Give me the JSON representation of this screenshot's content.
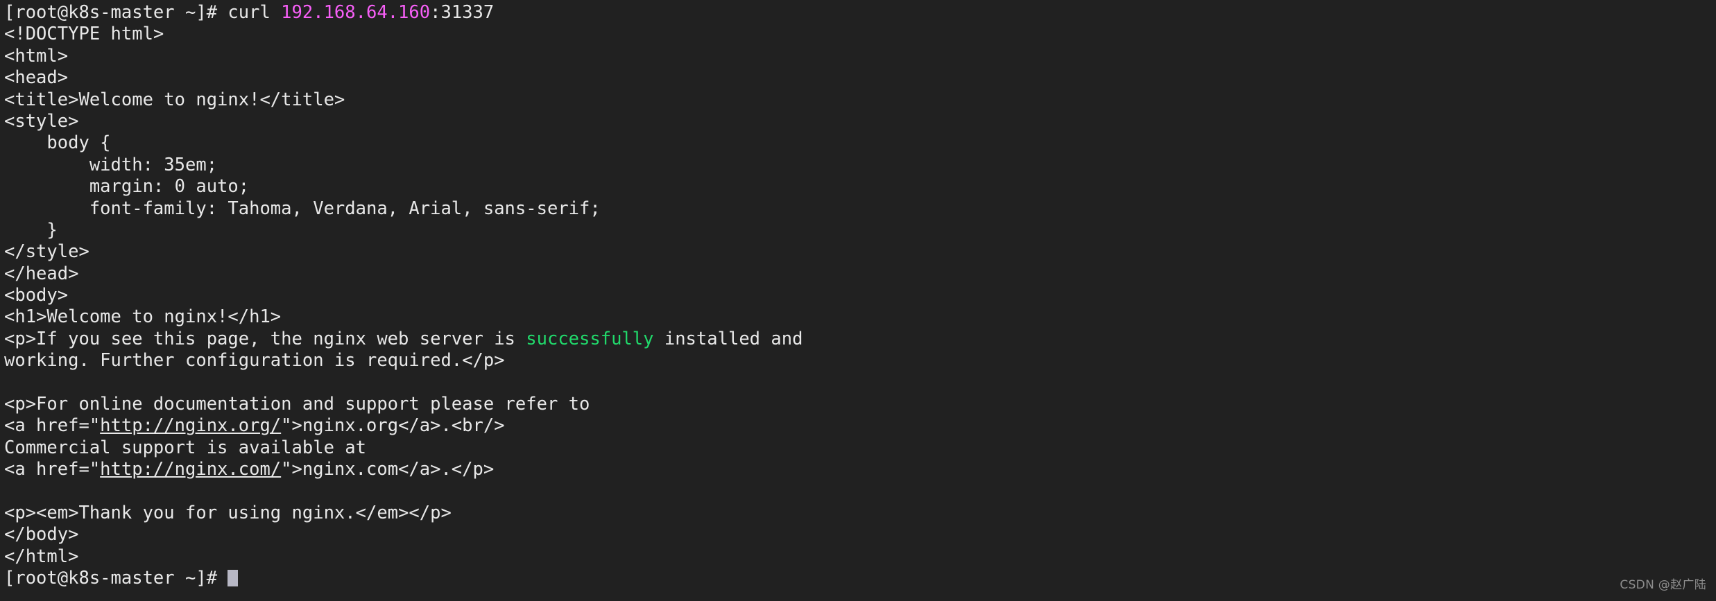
{
  "terminal": {
    "background_color": "#212121",
    "foreground_color": "#e8e8e8",
    "magenta_color": "#f75ff7",
    "green_color": "#21d96b",
    "cursor_color": "#b7b7c4",
    "prompt": "[root@k8s-master ~]# ",
    "command": "curl ",
    "host": "192.168.64.160",
    "port": ":31337",
    "lines": [
      {
        "id": "line-1-prompt-command",
        "segments": [
          {
            "text": "[root@k8s-master ~]# curl ",
            "color": "default"
          },
          {
            "text": "192.168.64.160",
            "color": "magenta"
          },
          {
            "text": ":31337",
            "color": "default"
          }
        ]
      },
      {
        "id": "line-2",
        "segments": [
          {
            "text": "<!DOCTYPE html>",
            "color": "default"
          }
        ]
      },
      {
        "id": "line-3",
        "segments": [
          {
            "text": "<html>",
            "color": "default"
          }
        ]
      },
      {
        "id": "line-4",
        "segments": [
          {
            "text": "<head>",
            "color": "default"
          }
        ]
      },
      {
        "id": "line-5",
        "segments": [
          {
            "text": "<title>Welcome to nginx!</title>",
            "color": "default"
          }
        ]
      },
      {
        "id": "line-6",
        "segments": [
          {
            "text": "<style>",
            "color": "default"
          }
        ]
      },
      {
        "id": "line-7",
        "segments": [
          {
            "text": "    body {",
            "color": "default"
          }
        ]
      },
      {
        "id": "line-8",
        "segments": [
          {
            "text": "        width: 35em;",
            "color": "default"
          }
        ]
      },
      {
        "id": "line-9",
        "segments": [
          {
            "text": "        margin: 0 auto;",
            "color": "default"
          }
        ]
      },
      {
        "id": "line-10",
        "segments": [
          {
            "text": "        font-family: Tahoma, Verdana, Arial, sans-serif;",
            "color": "default"
          }
        ]
      },
      {
        "id": "line-11",
        "segments": [
          {
            "text": "    }",
            "color": "default"
          }
        ]
      },
      {
        "id": "line-12",
        "segments": [
          {
            "text": "</style>",
            "color": "default"
          }
        ]
      },
      {
        "id": "line-13",
        "segments": [
          {
            "text": "</head>",
            "color": "default"
          }
        ]
      },
      {
        "id": "line-14",
        "segments": [
          {
            "text": "<body>",
            "color": "default"
          }
        ]
      },
      {
        "id": "line-15",
        "segments": [
          {
            "text": "<h1>Welcome to nginx!</h1>",
            "color": "default"
          }
        ]
      },
      {
        "id": "line-16",
        "segments": [
          {
            "text": "<p>If you see this page, the nginx web server is ",
            "color": "default"
          },
          {
            "text": "successfully",
            "color": "green"
          },
          {
            "text": " installed and",
            "color": "default"
          }
        ]
      },
      {
        "id": "line-17",
        "segments": [
          {
            "text": "working. Further configuration is required.</p>",
            "color": "default"
          }
        ]
      },
      {
        "id": "line-18",
        "segments": [
          {
            "text": "",
            "color": "default"
          }
        ]
      },
      {
        "id": "line-19",
        "segments": [
          {
            "text": "<p>For online documentation and support please refer to",
            "color": "default"
          }
        ]
      },
      {
        "id": "line-20",
        "segments": [
          {
            "text": "<a href=\"",
            "color": "default"
          },
          {
            "text": "http://nginx.org/",
            "color": "link"
          },
          {
            "text": "\">nginx.org</a>.<br/>",
            "color": "default"
          }
        ]
      },
      {
        "id": "line-21",
        "segments": [
          {
            "text": "Commercial support is available at",
            "color": "default"
          }
        ]
      },
      {
        "id": "line-22",
        "segments": [
          {
            "text": "<a href=\"",
            "color": "default"
          },
          {
            "text": "http://nginx.com/",
            "color": "link"
          },
          {
            "text": "\">nginx.com</a>.</p>",
            "color": "default"
          }
        ]
      },
      {
        "id": "line-23",
        "segments": [
          {
            "text": "",
            "color": "default"
          }
        ]
      },
      {
        "id": "line-24",
        "segments": [
          {
            "text": "<p><em>Thank you for using nginx.</em></p>",
            "color": "default"
          }
        ]
      },
      {
        "id": "line-25",
        "segments": [
          {
            "text": "</body>",
            "color": "default"
          }
        ]
      },
      {
        "id": "line-26",
        "segments": [
          {
            "text": "</html>",
            "color": "default"
          }
        ]
      },
      {
        "id": "line-27-prompt",
        "segments": [
          {
            "text": "[root@k8s-master ~]# ",
            "color": "default"
          },
          {
            "text": "",
            "color": "cursor"
          }
        ]
      }
    ]
  },
  "watermark": {
    "text": "CSDN @赵广陆"
  }
}
